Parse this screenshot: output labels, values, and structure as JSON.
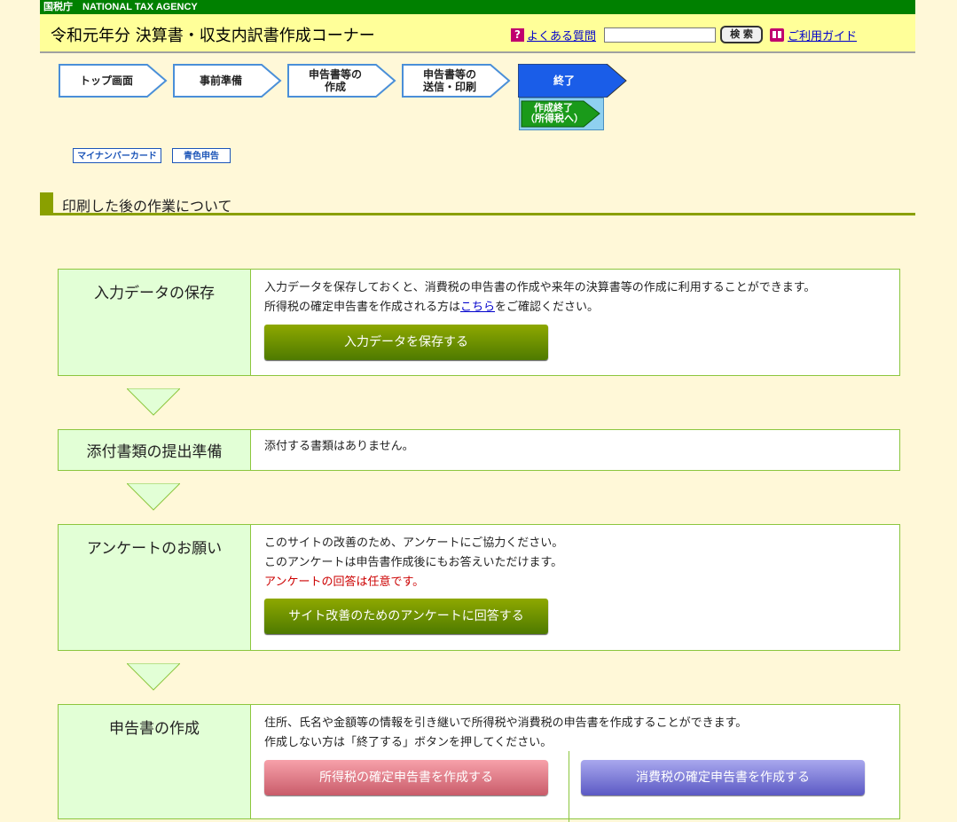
{
  "agency": "国税庁　NATIONAL TAX AGENCY",
  "header": {
    "title": "令和元年分 決算書・収支内訳書作成コーナー",
    "faq_icon": "?",
    "faq_label": "よくある質問",
    "search_value": "",
    "search_button": "検 索",
    "guide_label": "ご利用ガイド"
  },
  "steps": [
    {
      "line1": "トップ画面",
      "line2": ""
    },
    {
      "line1": "事前準備",
      "line2": ""
    },
    {
      "line1": "申告書等の",
      "line2": "作成"
    },
    {
      "line1": "申告書等の",
      "line2": "送信・印刷"
    },
    {
      "line1": "終了",
      "line2": ""
    }
  ],
  "finish_button": {
    "line1": "作成終了",
    "line2": "（所得税へ）"
  },
  "badges": {
    "mynumber": "マイナンバーカード",
    "blue": "青色申告"
  },
  "section_title": "印刷した後の作業について",
  "panels": {
    "save": {
      "title": "入力データの保存",
      "line1": "入力データを保存しておくと、消費税の申告書の作成や来年の決算書等の作成に利用することができます。",
      "line2_pre": "所得税の確定申告書を作成される方は",
      "line2_link": "こちら",
      "line2_post": "をご確認ください。",
      "button": "入力データを保存する"
    },
    "attach": {
      "title": "添付書類の提出準備",
      "line1": "添付する書類はありません。"
    },
    "survey": {
      "title": "アンケートのお願い",
      "line1": "このサイトの改善のため、アンケートにご協力ください。",
      "line2": "このアンケートは申告書作成後にもお答えいただけます。",
      "line3": "アンケートの回答は任意です。",
      "button": "サイト改善のためのアンケートに回答する"
    },
    "create": {
      "title": "申告書の作成",
      "line1": "住所、氏名や金額等の情報を引き継いで所得税や消費税の申告書を作成することができます。",
      "line2": "作成しない方は「終了する」ボタンを押してください。",
      "income_button": "所得税の確定申告書を作成する",
      "consumption_button": "消費税の確定申告書を作成する"
    }
  }
}
